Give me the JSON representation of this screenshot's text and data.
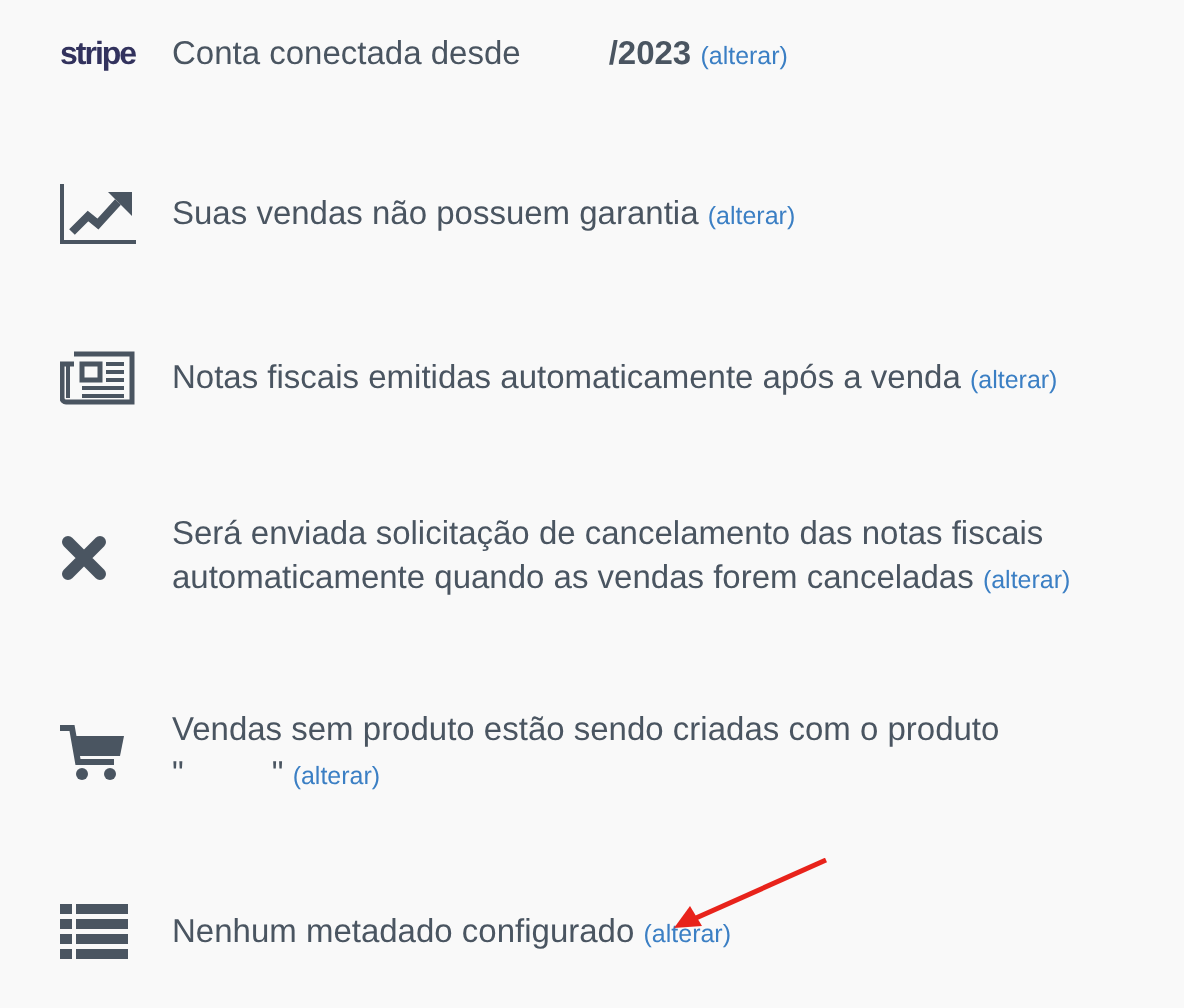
{
  "items": [
    {
      "kind": "stripe",
      "logo": "stripe",
      "segments": [
        {
          "kind": "text",
          "text": "Conta conectada desde"
        },
        {
          "kind": "blank"
        },
        {
          "kind": "bold",
          "text": "/2023"
        }
      ],
      "link": "(alterar)",
      "annotated": false
    },
    {
      "kind": "chart",
      "segments": [
        {
          "kind": "text",
          "text": "Suas vendas não possuem garantia"
        }
      ],
      "link": "(alterar)",
      "annotated": false
    },
    {
      "kind": "newspaper",
      "segments": [
        {
          "kind": "text",
          "text": "Notas fiscais emitidas automaticamente após a venda"
        }
      ],
      "link": "(alterar)",
      "annotated": false
    },
    {
      "kind": "cancel",
      "segments": [
        {
          "kind": "text",
          "text": "Será enviada solicitação de cancelamento das notas fiscais automaticamente quando as vendas forem canceladas"
        }
      ],
      "link": "(alterar)",
      "annotated": false
    },
    {
      "kind": "cart",
      "segments": [
        {
          "kind": "text",
          "text": "Vendas sem produto estão sendo criadas com o produto"
        },
        {
          "kind": "break"
        },
        {
          "kind": "text",
          "text": "\""
        },
        {
          "kind": "blank"
        },
        {
          "kind": "text",
          "text": "\""
        }
      ],
      "link": "(alterar)",
      "annotated": false
    },
    {
      "kind": "list",
      "segments": [
        {
          "kind": "text",
          "text": "Nenhum metadado configurado"
        }
      ],
      "link": "(alterar)",
      "annotated": true
    }
  ]
}
